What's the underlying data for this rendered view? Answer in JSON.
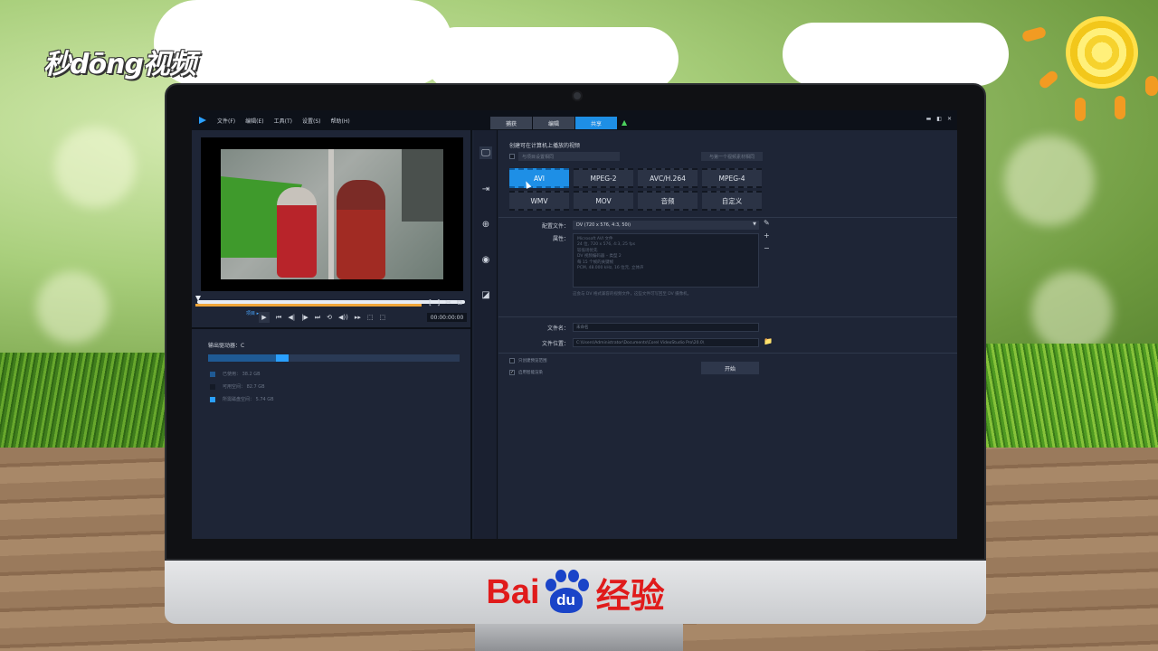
{
  "watermark": {
    "logo_text": "秒dōng视频"
  },
  "brand": {
    "baidu_text": "Bai",
    "baidu_paw_text": "du",
    "baidu_cn": "经验"
  },
  "app": {
    "menu": [
      "文件(F)",
      "编辑(E)",
      "工具(T)",
      "设置(S)",
      "帮助(H)"
    ],
    "mode_tabs": [
      {
        "label": "捕获",
        "active": false
      },
      {
        "label": "编辑",
        "active": false
      },
      {
        "label": "共享",
        "active": true
      }
    ],
    "window_controls": [
      "▬",
      "◧",
      "✕"
    ],
    "accent_color": "#1e8fe6",
    "preview": {
      "tiny_label": "项目 ▸",
      "timecode": "00:00:00:00",
      "trim": [
        "[",
        "]",
        "✂",
        "⧉"
      ],
      "controls": [
        "▶",
        "⏮",
        "◀|",
        "|▶",
        "⏭",
        "⟲",
        "◀))",
        "▸▸",
        "⬚",
        "⬚"
      ]
    },
    "output": {
      "drive_label": "输出驱动器：C",
      "used_fraction": 0.27,
      "needed_fraction": 0.05,
      "legend": [
        {
          "label": "已使用：  38.2 GB",
          "color": "#1f5a94"
        },
        {
          "label": "可用空间：  82.7 GB",
          "color": "#141a26"
        },
        {
          "label": "所需磁盘空间：  5.74 GB",
          "color": "#2aa0ff"
        }
      ]
    },
    "side_icons": [
      {
        "name": "computer-icon",
        "glyph": "🖵"
      },
      {
        "name": "device-icon",
        "glyph": "⇥"
      },
      {
        "name": "web-icon",
        "glyph": "⊕"
      },
      {
        "name": "disc-icon",
        "glyph": "◉"
      },
      {
        "name": "3d-icon",
        "glyph": "◪"
      }
    ],
    "share": {
      "title": "创建可在计算机上播放的视频",
      "top_dropdown": "与项目设置相同",
      "top_button": "与第一个视频素材相同",
      "formats": [
        {
          "label": "AVI",
          "active": true
        },
        {
          "label": "MPEG-2",
          "active": false
        },
        {
          "label": "AVC/H.264",
          "active": false
        },
        {
          "label": "MPEG-4",
          "active": false
        },
        {
          "label": "WMV",
          "active": false
        },
        {
          "label": "MOV",
          "active": false
        },
        {
          "label": "音频",
          "active": false
        },
        {
          "label": "自定义",
          "active": false
        }
      ],
      "profile_label": "配置文件：",
      "profile_value": "DV (720 x 576, 4:3, 50i)",
      "properties_label": "属性：",
      "properties": [
        "Microsoft AVI 文件",
        "24 位, 720 x 576, 4:3, 25 fps",
        "较低场优先",
        "DV 视频编码器 – 类型 2",
        "每 15 个帧的关键帧",
        "PCM, 48.000 kHz, 16 位元, 立体声"
      ],
      "note": "这会与 DV 格式兼容的视频文件，这些文件可写回至 DV 摄像机。",
      "filename_label": "文件名：",
      "filename_value": "未命名",
      "location_label": "文件位置：",
      "location_value": "C:\\Users\\Administrator\\Documents\\Corel VideoStudio Pro\\20.0\\",
      "opt1": "只创建预览范围",
      "opt2": "启用智能渲染",
      "opt2_checked": true,
      "start_label": "开始",
      "side_tools": [
        "✎",
        "+",
        "−"
      ]
    }
  }
}
